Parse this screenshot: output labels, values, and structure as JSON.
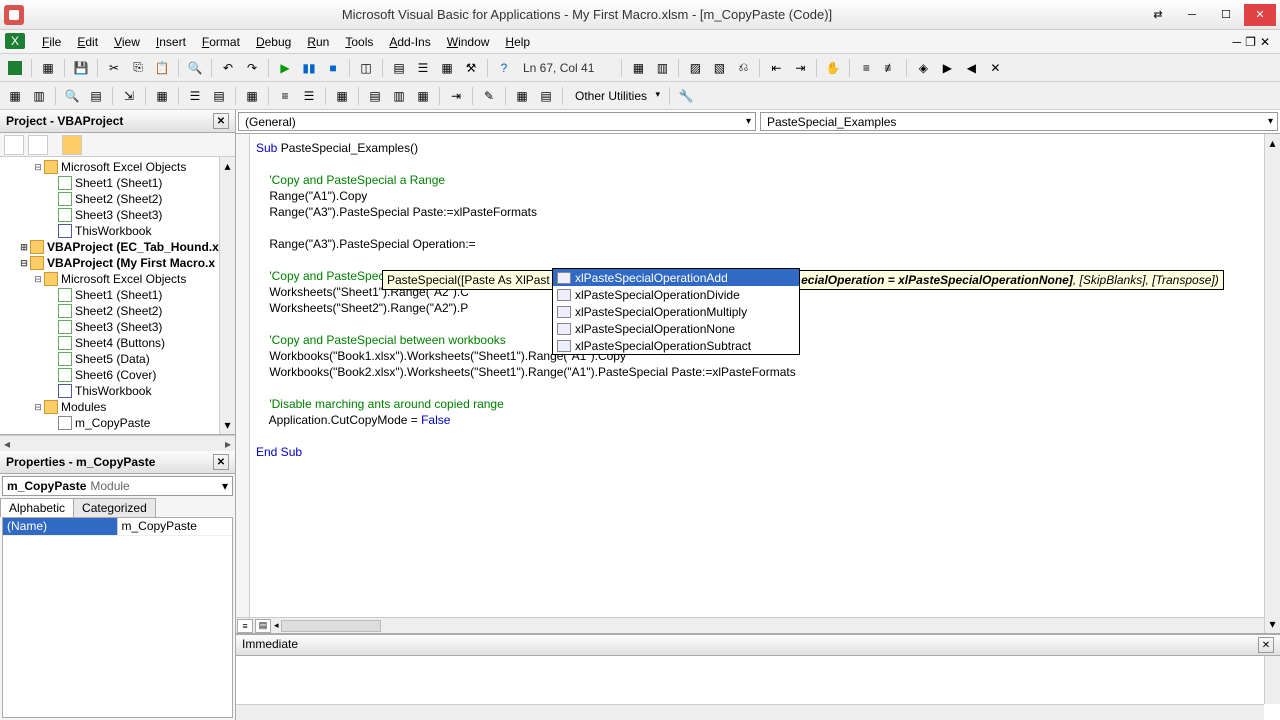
{
  "title": "Microsoft Visual Basic for Applications - My First Macro.xlsm - [m_CopyPaste (Code)]",
  "menu": [
    "File",
    "Edit",
    "View",
    "Insert",
    "Format",
    "Debug",
    "Run",
    "Tools",
    "Add-Ins",
    "Window",
    "Help"
  ],
  "status_pos": "Ln 67, Col 41",
  "other_util": "Other Utilities",
  "project": {
    "title": "Project - VBAProject",
    "nodes": [
      {
        "lvl": 2,
        "t": "Microsoft Excel Objects",
        "ico": "folder",
        "exp": "-",
        "bold": false
      },
      {
        "lvl": 3,
        "t": "Sheet1 (Sheet1)",
        "ico": "sheet"
      },
      {
        "lvl": 3,
        "t": "Sheet2 (Sheet2)",
        "ico": "sheet"
      },
      {
        "lvl": 3,
        "t": "Sheet3 (Sheet3)",
        "ico": "sheet"
      },
      {
        "lvl": 3,
        "t": "ThisWorkbook",
        "ico": "book"
      },
      {
        "lvl": 1,
        "t": "VBAProject (EC_Tab_Hound.x",
        "ico": "folder",
        "exp": "+",
        "bold": true
      },
      {
        "lvl": 1,
        "t": "VBAProject (My First Macro.x",
        "ico": "folder",
        "exp": "-",
        "bold": true
      },
      {
        "lvl": 2,
        "t": "Microsoft Excel Objects",
        "ico": "folder",
        "exp": "-"
      },
      {
        "lvl": 3,
        "t": "Sheet1 (Sheet1)",
        "ico": "sheet"
      },
      {
        "lvl": 3,
        "t": "Sheet2 (Sheet2)",
        "ico": "sheet"
      },
      {
        "lvl": 3,
        "t": "Sheet3 (Sheet3)",
        "ico": "sheet"
      },
      {
        "lvl": 3,
        "t": "Sheet4 (Buttons)",
        "ico": "sheet"
      },
      {
        "lvl": 3,
        "t": "Sheet5 (Data)",
        "ico": "sheet"
      },
      {
        "lvl": 3,
        "t": "Sheet6 (Cover)",
        "ico": "sheet"
      },
      {
        "lvl": 3,
        "t": "ThisWorkbook",
        "ico": "book"
      },
      {
        "lvl": 2,
        "t": "Modules",
        "ico": "folder",
        "exp": "-"
      },
      {
        "lvl": 3,
        "t": "m_CopyPaste",
        "ico": "mod"
      }
    ]
  },
  "properties": {
    "title": "Properties - m_CopyPaste",
    "combo_name": "m_CopyPaste",
    "combo_type": "Module",
    "tabs": [
      "Alphabetic",
      "Categorized"
    ],
    "row_key": "(Name)",
    "row_val": "m_CopyPaste"
  },
  "code": {
    "object_combo": "(General)",
    "proc_combo": "PasteSpecial_Examples",
    "lines": [
      {
        "t": "kw",
        "s": "Sub "
      },
      {
        "t": "",
        "s": "PasteSpecial_Examples()"
      },
      {
        "br": 1
      },
      {
        "br": 1
      },
      {
        "t": "cm",
        "s": "    'Copy and PasteSpecial a Range"
      },
      {
        "br": 1
      },
      {
        "s": "    Range("
      },
      {
        "t": "str",
        "s": "\"A1\""
      },
      {
        "s": ").Copy"
      },
      {
        "br": 1
      },
      {
        "s": "    Range("
      },
      {
        "t": "str",
        "s": "\"A3\""
      },
      {
        "s": ").PasteSpecial Paste:=xlPasteFormats"
      },
      {
        "br": 1
      },
      {
        "br": 1
      },
      {
        "s": "    Range("
      },
      {
        "t": "str",
        "s": "\"A3\""
      },
      {
        "s": ").PasteSpecial Operation:="
      },
      {
        "br": 1
      },
      {
        "br": 1
      },
      {
        "t": "cm",
        "s": "    'Copy and PasteSpecial a between w"
      },
      {
        "br": 1
      },
      {
        "s": "    Worksheets("
      },
      {
        "t": "str",
        "s": "\"Sheet1\""
      },
      {
        "s": ").Range("
      },
      {
        "t": "str",
        "s": "\"A2\""
      },
      {
        "s": ").C"
      },
      {
        "br": 1
      },
      {
        "s": "    Worksheets("
      },
      {
        "t": "str",
        "s": "\"Sheet2\""
      },
      {
        "s": ").Range("
      },
      {
        "t": "str",
        "s": "\"A2\""
      },
      {
        "s": ").P                          las"
      },
      {
        "br": 1
      },
      {
        "br": 1
      },
      {
        "t": "cm",
        "s": "    'Copy and PasteSpecial between workbooks"
      },
      {
        "br": 1
      },
      {
        "s": "    Workbooks("
      },
      {
        "t": "str",
        "s": "\"Book1.xlsx\""
      },
      {
        "s": ").Worksheets("
      },
      {
        "t": "str",
        "s": "\"Sheet1\""
      },
      {
        "s": ").Range("
      },
      {
        "t": "str",
        "s": "\"A1\""
      },
      {
        "s": ").Copy"
      },
      {
        "br": 1
      },
      {
        "s": "    Workbooks("
      },
      {
        "t": "str",
        "s": "\"Book2.xlsx\""
      },
      {
        "s": ").Worksheets("
      },
      {
        "t": "str",
        "s": "\"Sheet1\""
      },
      {
        "s": ").Range("
      },
      {
        "t": "str",
        "s": "\"A1\""
      },
      {
        "s": ").PasteSpecial Paste:=xlPasteFormats"
      },
      {
        "br": 1
      },
      {
        "br": 1
      },
      {
        "t": "cm",
        "s": "    'Disable marching ants around copied range"
      },
      {
        "br": 1
      },
      {
        "s": "    Application.CutCopyMode = "
      },
      {
        "t": "kw",
        "s": "False"
      },
      {
        "br": 1
      },
      {
        "br": 1
      },
      {
        "t": "kw",
        "s": "End Sub"
      }
    ],
    "sig_before": "PasteSpecial([Paste As XlPast",
    "sig_hidden": "ecialOperation = xlPasteSpecialOperationNone]",
    "sig_after": ", [SkipBlanks], [Transpose])",
    "autocomplete": [
      "xlPasteSpecialOperationAdd",
      "xlPasteSpecialOperationDivide",
      "xlPasteSpecialOperationMultiply",
      "xlPasteSpecialOperationNone",
      "xlPasteSpecialOperationSubtract"
    ]
  },
  "immediate": {
    "title": "Immediate"
  }
}
